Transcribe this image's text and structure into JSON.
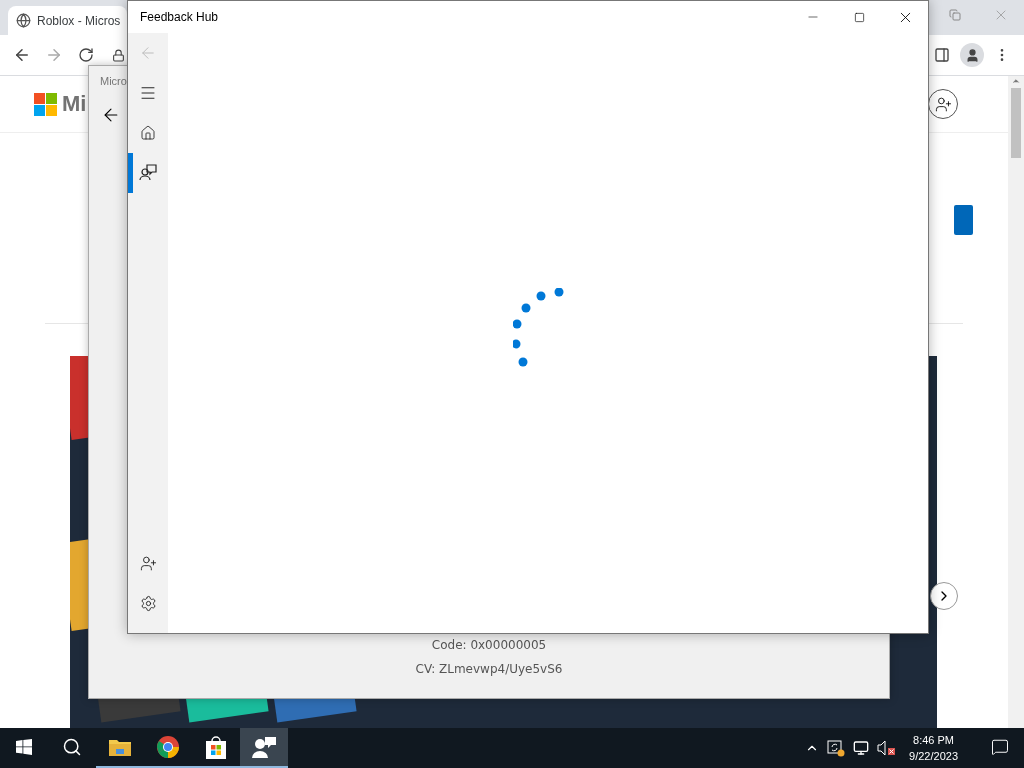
{
  "browser": {
    "tab_title": "Roblox - Micros",
    "brand": "Mi"
  },
  "store_dialog": {
    "title": "Micro",
    "error_code": "Code: 0x00000005",
    "cv": "CV: ZLmevwp4/Uye5vS6"
  },
  "feedback_hub": {
    "title": "Feedback Hub",
    "nav_top": [
      {
        "kind": "back",
        "disabled": true
      },
      {
        "kind": "menu"
      },
      {
        "kind": "home",
        "selected": false
      },
      {
        "kind": "feedback",
        "selected": true
      }
    ],
    "nav_bottom": [
      {
        "kind": "account"
      },
      {
        "kind": "settings"
      }
    ]
  },
  "taskbar": {
    "apps": [
      {
        "kind": "explorer",
        "running": true,
        "active": false
      },
      {
        "kind": "chrome",
        "running": true,
        "active": false
      },
      {
        "kind": "store",
        "running": true,
        "active": false
      },
      {
        "kind": "feedback",
        "running": true,
        "active": true
      }
    ],
    "clock": {
      "time": "8:46 PM",
      "date": "9/22/2023"
    }
  }
}
